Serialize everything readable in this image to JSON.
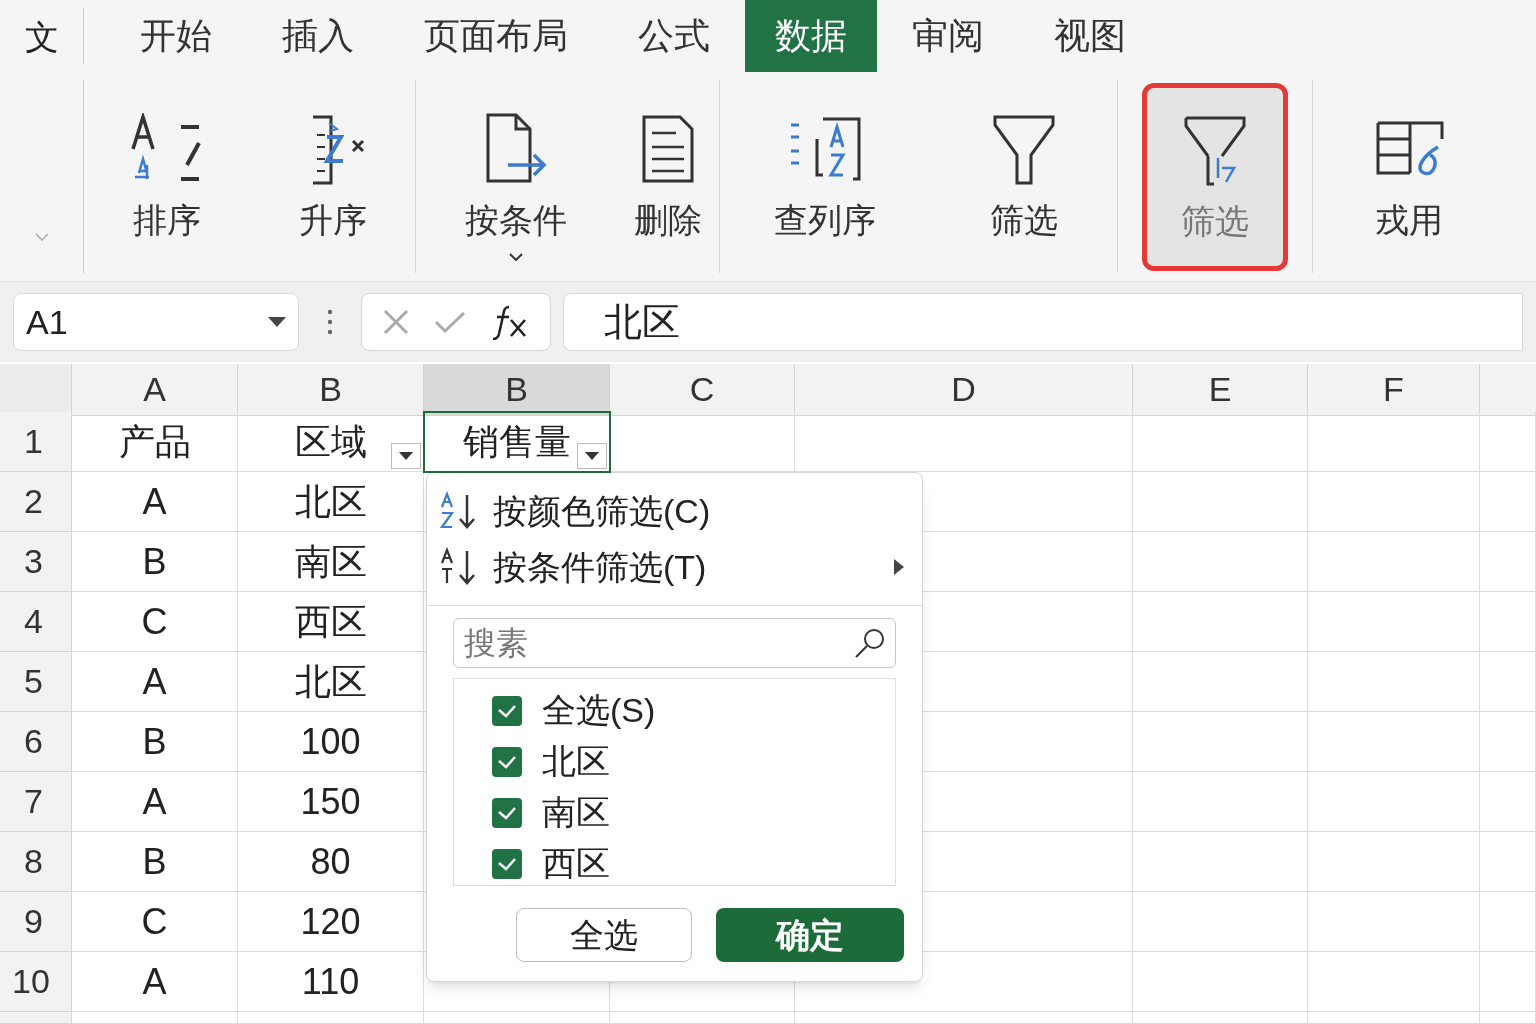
{
  "quick_access": {
    "label": "文"
  },
  "ribbon_tabs": [
    {
      "label": "开始",
      "selected": false
    },
    {
      "label": "插入",
      "selected": false
    },
    {
      "label": "页面布局",
      "selected": false
    },
    {
      "label": "公式",
      "selected": false
    },
    {
      "label": "数据",
      "selected": true
    },
    {
      "label": "审阅",
      "selected": false
    },
    {
      "label": "视图",
      "selected": false
    }
  ],
  "ribbon_buttons": [
    {
      "label": "排序",
      "kind": "sort",
      "selected": false,
      "dropdown": false
    },
    {
      "label": "升序",
      "kind": "ascending",
      "selected": false,
      "dropdown": false
    },
    {
      "label": "按条件",
      "kind": "conditional",
      "selected": false,
      "dropdown": true
    },
    {
      "label": "删除",
      "kind": "delete",
      "selected": false,
      "dropdown": false
    },
    {
      "label": "查列序",
      "kind": "column_order",
      "selected": false,
      "dropdown": false
    },
    {
      "label": "筛选",
      "kind": "filter",
      "selected": false,
      "dropdown": false
    },
    {
      "label": "筛选",
      "kind": "filter_clear",
      "selected": true,
      "dropdown": false
    },
    {
      "label": "戎用",
      "kind": "apply",
      "selected": false,
      "dropdown": false
    }
  ],
  "name_box": {
    "value": "A1"
  },
  "formula_bar": {
    "value": "北区"
  },
  "column_headers": [
    {
      "label": "A",
      "selected": false
    },
    {
      "label": "B",
      "selected": false
    },
    {
      "label": "B",
      "selected": true
    },
    {
      "label": "C",
      "selected": false
    },
    {
      "label": "D",
      "selected": false
    },
    {
      "label": "E",
      "selected": false
    },
    {
      "label": "F",
      "selected": false
    }
  ],
  "rows": [
    {
      "number": "1",
      "cells": [
        {
          "text": "产品",
          "filter": false,
          "selected": false
        },
        {
          "text": "区域",
          "filter": true,
          "selected": false
        },
        {
          "text": "销售量",
          "filter": true,
          "selected": true
        }
      ]
    },
    {
      "number": "2",
      "cells": [
        "A",
        "北区"
      ]
    },
    {
      "number": "3",
      "cells": [
        "B",
        "南区"
      ]
    },
    {
      "number": "4",
      "cells": [
        "C",
        "西区"
      ]
    },
    {
      "number": "5",
      "cells": [
        "A",
        "北区"
      ]
    },
    {
      "number": "6",
      "cells": [
        "B",
        "100"
      ]
    },
    {
      "number": "7",
      "cells": [
        "A",
        "150"
      ]
    },
    {
      "number": "8",
      "cells": [
        "B",
        "80"
      ]
    },
    {
      "number": "9",
      "cells": [
        "C",
        "120"
      ]
    },
    {
      "number": "10",
      "cells": [
        "A",
        "110"
      ]
    }
  ],
  "filter_menu": {
    "commands": [
      {
        "label": "按颜色筛选(C)",
        "kind": "sort_az",
        "submenu": false
      },
      {
        "label": "按条件筛选(T)",
        "kind": "sort_at",
        "submenu": true
      }
    ],
    "search": {
      "placeholder": "搜素"
    },
    "options": [
      {
        "label": "全选(S)",
        "checked": true
      },
      {
        "label": "北区",
        "checked": true
      },
      {
        "label": "南区",
        "checked": true
      },
      {
        "label": "西区",
        "checked": true
      }
    ],
    "buttons": [
      {
        "label": "全选",
        "kind": "secondary"
      },
      {
        "label": "确定",
        "kind": "primary"
      }
    ]
  }
}
